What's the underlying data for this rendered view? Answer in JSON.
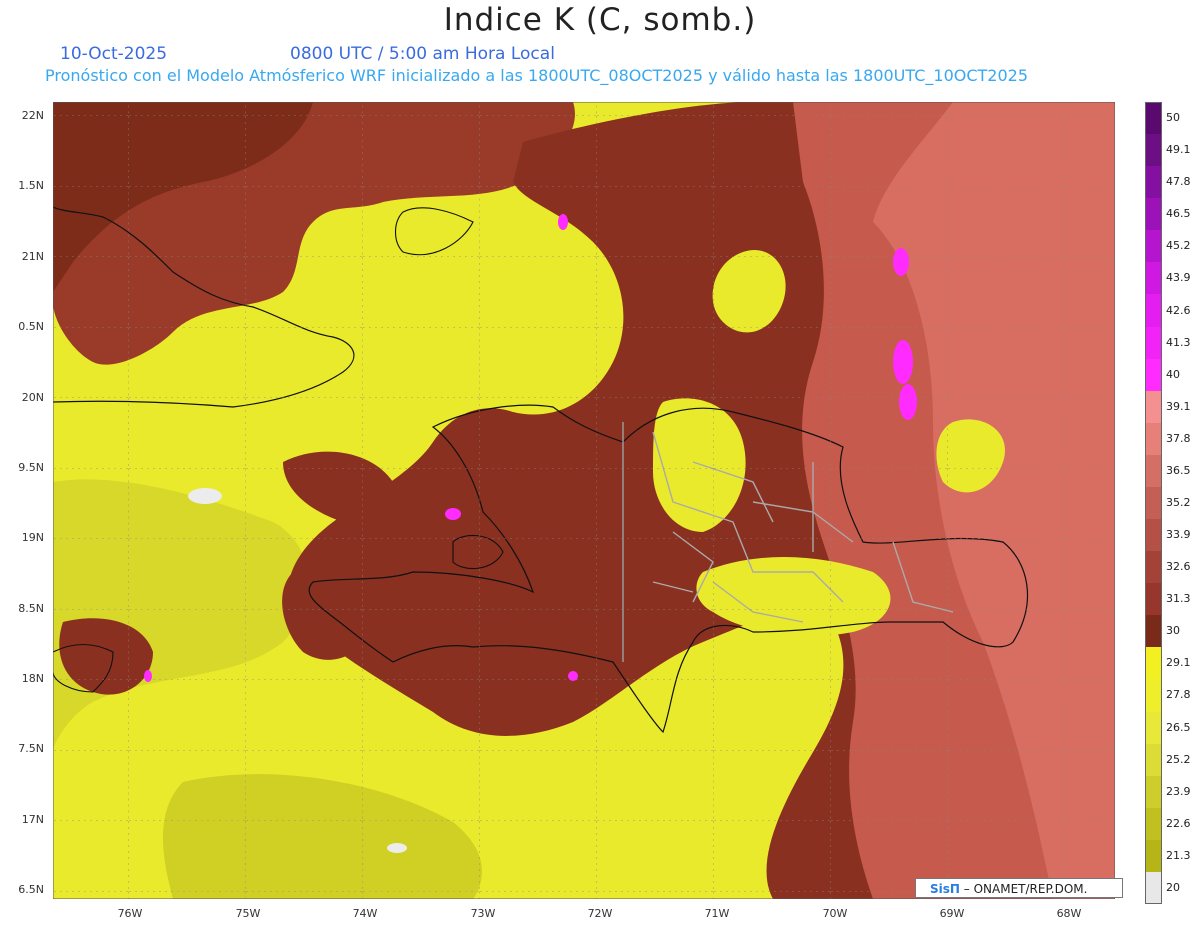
{
  "header": {
    "title": "Indice K (C, somb.)",
    "date": "10-Oct-2025",
    "time": "0800 UTC / 5:00 am Hora Local",
    "subtitle": "Pronóstico con el Modelo Atmósferico WRF inicializado a las 1800UTC_08OCT2025 y válido hasta las  1800UTC_10OCT2025"
  },
  "map": {
    "lat_labels": [
      "22N",
      "1.5N",
      "21N",
      "0.5N",
      "20N",
      "9.5N",
      "19N",
      "8.5N",
      "18N",
      "7.5N",
      "17N",
      "6.5N"
    ],
    "lon_labels": [
      "76W",
      "75W",
      "74W",
      "73W",
      "72W",
      "71W",
      "70W",
      "69W",
      "68W"
    ]
  },
  "colorbar": {
    "labels": [
      "50",
      "49.1",
      "47.8",
      "46.5",
      "45.2",
      "43.9",
      "42.6",
      "41.3",
      "40",
      "39.1",
      "37.8",
      "36.5",
      "35.2",
      "33.9",
      "32.6",
      "31.3",
      "30",
      "29.1",
      "27.8",
      "26.5",
      "25.2",
      "23.9",
      "22.6",
      "21.3",
      "20"
    ],
    "colors": [
      "#5a0a6e",
      "#6d0e85",
      "#850fa0",
      "#9c12b8",
      "#b615d0",
      "#cf18e2",
      "#e41ef0",
      "#f223f7",
      "#ff2bff",
      "#f59090",
      "#e8807a",
      "#d46f66",
      "#c45f55",
      "#b55046",
      "#a54238",
      "#96362c",
      "#7a2a18",
      "#f2f020",
      "#eeee2a",
      "#e8e838",
      "#dcdc36",
      "#cdcd2c",
      "#c0c020",
      "#b5b518",
      "#e8e8e8"
    ]
  },
  "credit": {
    "logo": "SisΠ",
    "text": " – ONAMET/REP.DOM."
  }
}
